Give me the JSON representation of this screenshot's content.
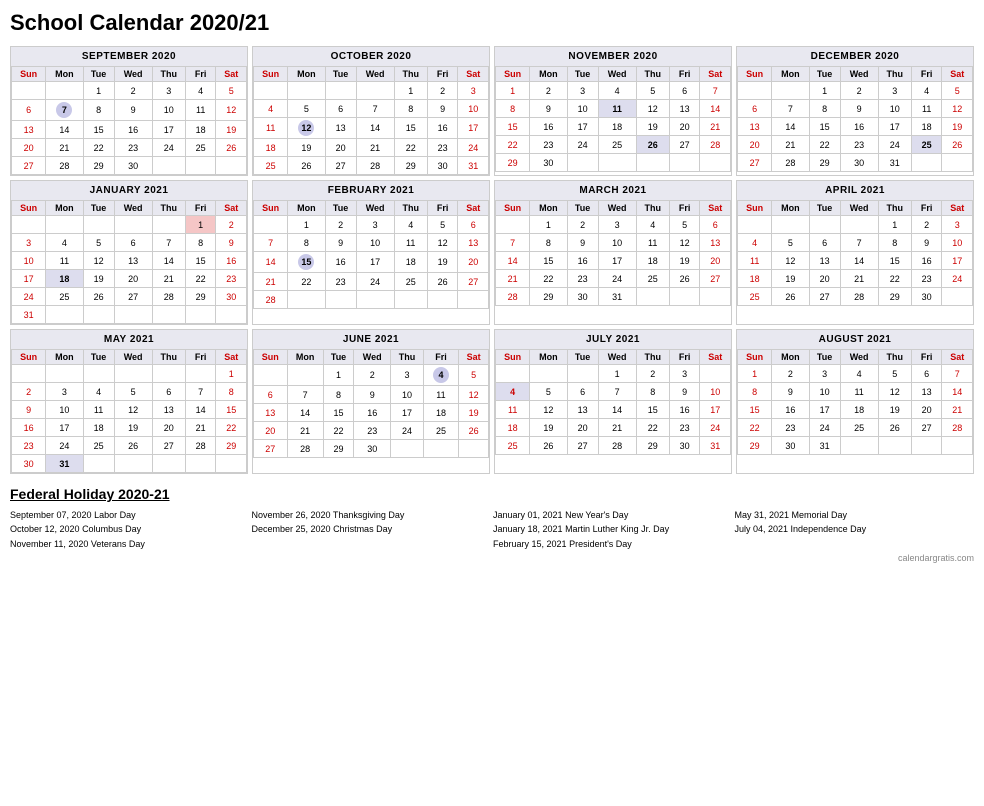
{
  "title": "School Calendar 2020/21",
  "months": [
    {
      "name": "SEPTEMBER 2020",
      "days": [
        [
          "",
          "",
          "1",
          "2",
          "3",
          "4",
          "5"
        ],
        [
          "6",
          "7",
          "8",
          "9",
          "10",
          "11",
          "12"
        ],
        [
          "13",
          "14",
          "15",
          "16",
          "17",
          "18",
          "19"
        ],
        [
          "20",
          "21",
          "22",
          "23",
          "24",
          "25",
          "26"
        ],
        [
          "27",
          "28",
          "29",
          "30",
          "",
          "",
          ""
        ]
      ],
      "highlights": {
        "7": {
          "type": "circle"
        }
      },
      "pink": {}
    },
    {
      "name": "OCTOBER 2020",
      "days": [
        [
          "",
          "",
          "",
          "",
          "1",
          "2",
          "3"
        ],
        [
          "4",
          "5",
          "6",
          "7",
          "8",
          "9",
          "10"
        ],
        [
          "11",
          "12",
          "13",
          "14",
          "15",
          "16",
          "17"
        ],
        [
          "18",
          "19",
          "20",
          "21",
          "22",
          "23",
          "24"
        ],
        [
          "25",
          "26",
          "27",
          "28",
          "29",
          "30",
          "31"
        ]
      ],
      "highlights": {
        "12": {
          "type": "circle"
        }
      },
      "pink": {}
    },
    {
      "name": "NOVEMBER 2020",
      "days": [
        [
          "1",
          "2",
          "3",
          "4",
          "5",
          "6",
          "7"
        ],
        [
          "8",
          "9",
          "10",
          "11",
          "12",
          "13",
          "14"
        ],
        [
          "15",
          "16",
          "17",
          "18",
          "19",
          "20",
          "21"
        ],
        [
          "22",
          "23",
          "24",
          "25",
          "26",
          "27",
          "28"
        ],
        [
          "29",
          "30",
          "",
          "",
          "",
          "",
          ""
        ]
      ],
      "highlights": {
        "11": {
          "type": "bold"
        },
        "26": {
          "type": "bold"
        }
      },
      "pink": {}
    },
    {
      "name": "DECEMBER 2020",
      "days": [
        [
          "",
          "",
          "1",
          "2",
          "3",
          "4",
          "5"
        ],
        [
          "6",
          "7",
          "8",
          "9",
          "10",
          "11",
          "12"
        ],
        [
          "13",
          "14",
          "15",
          "16",
          "17",
          "18",
          "19"
        ],
        [
          "20",
          "21",
          "22",
          "23",
          "24",
          "25",
          "26"
        ],
        [
          "27",
          "28",
          "29",
          "30",
          "31",
          "",
          ""
        ]
      ],
      "highlights": {
        "25": {
          "type": "bold"
        }
      },
      "pink": {
        "25": true
      }
    },
    {
      "name": "JANUARY 2021",
      "days": [
        [
          "",
          "",
          "",
          "",
          "",
          "1",
          "2"
        ],
        [
          "3",
          "4",
          "5",
          "6",
          "7",
          "8",
          "9"
        ],
        [
          "10",
          "11",
          "12",
          "13",
          "14",
          "15",
          "16"
        ],
        [
          "17",
          "18",
          "19",
          "20",
          "21",
          "22",
          "23"
        ],
        [
          "24",
          "25",
          "26",
          "27",
          "28",
          "29",
          "30"
        ],
        [
          "31",
          "",
          "",
          "",
          "",
          "",
          ""
        ]
      ],
      "highlights": {
        "1": {
          "type": "pink"
        },
        "18": {
          "type": "bold"
        }
      },
      "pink": {
        "1": true
      }
    },
    {
      "name": "FEBRUARY 2021",
      "days": [
        [
          "",
          "1",
          "2",
          "3",
          "4",
          "5",
          "6"
        ],
        [
          "7",
          "8",
          "9",
          "10",
          "11",
          "12",
          "13"
        ],
        [
          "14",
          "15",
          "16",
          "17",
          "18",
          "19",
          "20"
        ],
        [
          "21",
          "22",
          "23",
          "24",
          "25",
          "26",
          "27"
        ],
        [
          "28",
          "",
          "",
          "",
          "",
          "",
          ""
        ]
      ],
      "highlights": {
        "15": {
          "type": "circle"
        }
      },
      "pink": {}
    },
    {
      "name": "MARCH 2021",
      "days": [
        [
          "",
          "1",
          "2",
          "3",
          "4",
          "5",
          "6"
        ],
        [
          "7",
          "8",
          "9",
          "10",
          "11",
          "12",
          "13"
        ],
        [
          "14",
          "15",
          "16",
          "17",
          "18",
          "19",
          "20"
        ],
        [
          "21",
          "22",
          "23",
          "24",
          "25",
          "26",
          "27"
        ],
        [
          "28",
          "29",
          "30",
          "31",
          "",
          "",
          ""
        ]
      ],
      "highlights": {},
      "pink": {}
    },
    {
      "name": "APRIL 2021",
      "days": [
        [
          "",
          "",
          "",
          "",
          "1",
          "2",
          "3"
        ],
        [
          "4",
          "5",
          "6",
          "7",
          "8",
          "9",
          "10"
        ],
        [
          "11",
          "12",
          "13",
          "14",
          "15",
          "16",
          "17"
        ],
        [
          "18",
          "19",
          "20",
          "21",
          "22",
          "23",
          "24"
        ],
        [
          "25",
          "26",
          "27",
          "28",
          "29",
          "30",
          ""
        ]
      ],
      "highlights": {},
      "pink": {}
    },
    {
      "name": "MAY 2021",
      "days": [
        [
          "",
          "",
          "",
          "",
          "",
          "",
          "1"
        ],
        [
          "2",
          "3",
          "4",
          "5",
          "6",
          "7",
          "8"
        ],
        [
          "9",
          "10",
          "11",
          "12",
          "13",
          "14",
          "15"
        ],
        [
          "16",
          "17",
          "18",
          "19",
          "20",
          "21",
          "22"
        ],
        [
          "23",
          "24",
          "25",
          "26",
          "27",
          "28",
          "29"
        ],
        [
          "30",
          "31",
          "",
          "",
          "",
          "",
          ""
        ]
      ],
      "highlights": {
        "31": {
          "type": "bold"
        }
      },
      "pink": {
        "31": true
      }
    },
    {
      "name": "JUNE 2021",
      "days": [
        [
          "",
          "",
          "1",
          "2",
          "3",
          "4",
          "5"
        ],
        [
          "6",
          "7",
          "8",
          "9",
          "10",
          "11",
          "12"
        ],
        [
          "13",
          "14",
          "15",
          "16",
          "17",
          "18",
          "19"
        ],
        [
          "20",
          "21",
          "22",
          "23",
          "24",
          "25",
          "26"
        ],
        [
          "27",
          "28",
          "29",
          "30",
          "",
          "",
          ""
        ]
      ],
      "highlights": {
        "4": {
          "type": "circle"
        }
      },
      "pink": {}
    },
    {
      "name": "JULY 2021",
      "days": [
        [
          "",
          "",
          "",
          "1",
          "2",
          "3",
          ""
        ],
        [
          "4",
          "5",
          "6",
          "7",
          "8",
          "9",
          "10"
        ],
        [
          "11",
          "12",
          "13",
          "14",
          "15",
          "16",
          "17"
        ],
        [
          "18",
          "19",
          "20",
          "21",
          "22",
          "23",
          "24"
        ],
        [
          "25",
          "26",
          "27",
          "28",
          "29",
          "30",
          "31"
        ]
      ],
      "highlights": {
        "4": {
          "type": "bold"
        }
      },
      "pink": {
        "4": true
      }
    },
    {
      "name": "AUGUST 2021",
      "days": [
        [
          "1",
          "2",
          "3",
          "4",
          "5",
          "6",
          "7"
        ],
        [
          "8",
          "9",
          "10",
          "11",
          "12",
          "13",
          "14"
        ],
        [
          "15",
          "16",
          "17",
          "18",
          "19",
          "20",
          "21"
        ],
        [
          "22",
          "23",
          "24",
          "25",
          "26",
          "27",
          "28"
        ],
        [
          "29",
          "30",
          "31",
          "",
          "",
          "",
          ""
        ]
      ],
      "highlights": {},
      "pink": {}
    }
  ],
  "holidays_title": "Federal Holiday 2020-21",
  "holidays": [
    [
      {
        "date": "September 07, 2020",
        "name": "Labor Day"
      },
      {
        "date": "October 12, 2020",
        "name": "Columbus Day"
      },
      {
        "date": "November 11, 2020",
        "name": "Veterans Day"
      }
    ],
    [
      {
        "date": "November 26, 2020",
        "name": "Thanksgiving Day",
        "bold": true
      },
      {
        "date": "December 25, 2020",
        "name": "Christmas Day",
        "bold": true
      }
    ],
    [
      {
        "date": "January 01, 2021",
        "name": "New Year's Day"
      },
      {
        "date": "January 18, 2021",
        "name": "Martin Luther King Jr. Day"
      },
      {
        "date": "February 15, 2021",
        "name": "President's Day"
      }
    ],
    [
      {
        "date": "May 31, 2021",
        "name": "Memorial Day"
      },
      {
        "date": "July 04, 2021",
        "name": "Independence Day"
      }
    ]
  ],
  "watermark": "calendargratis.com"
}
